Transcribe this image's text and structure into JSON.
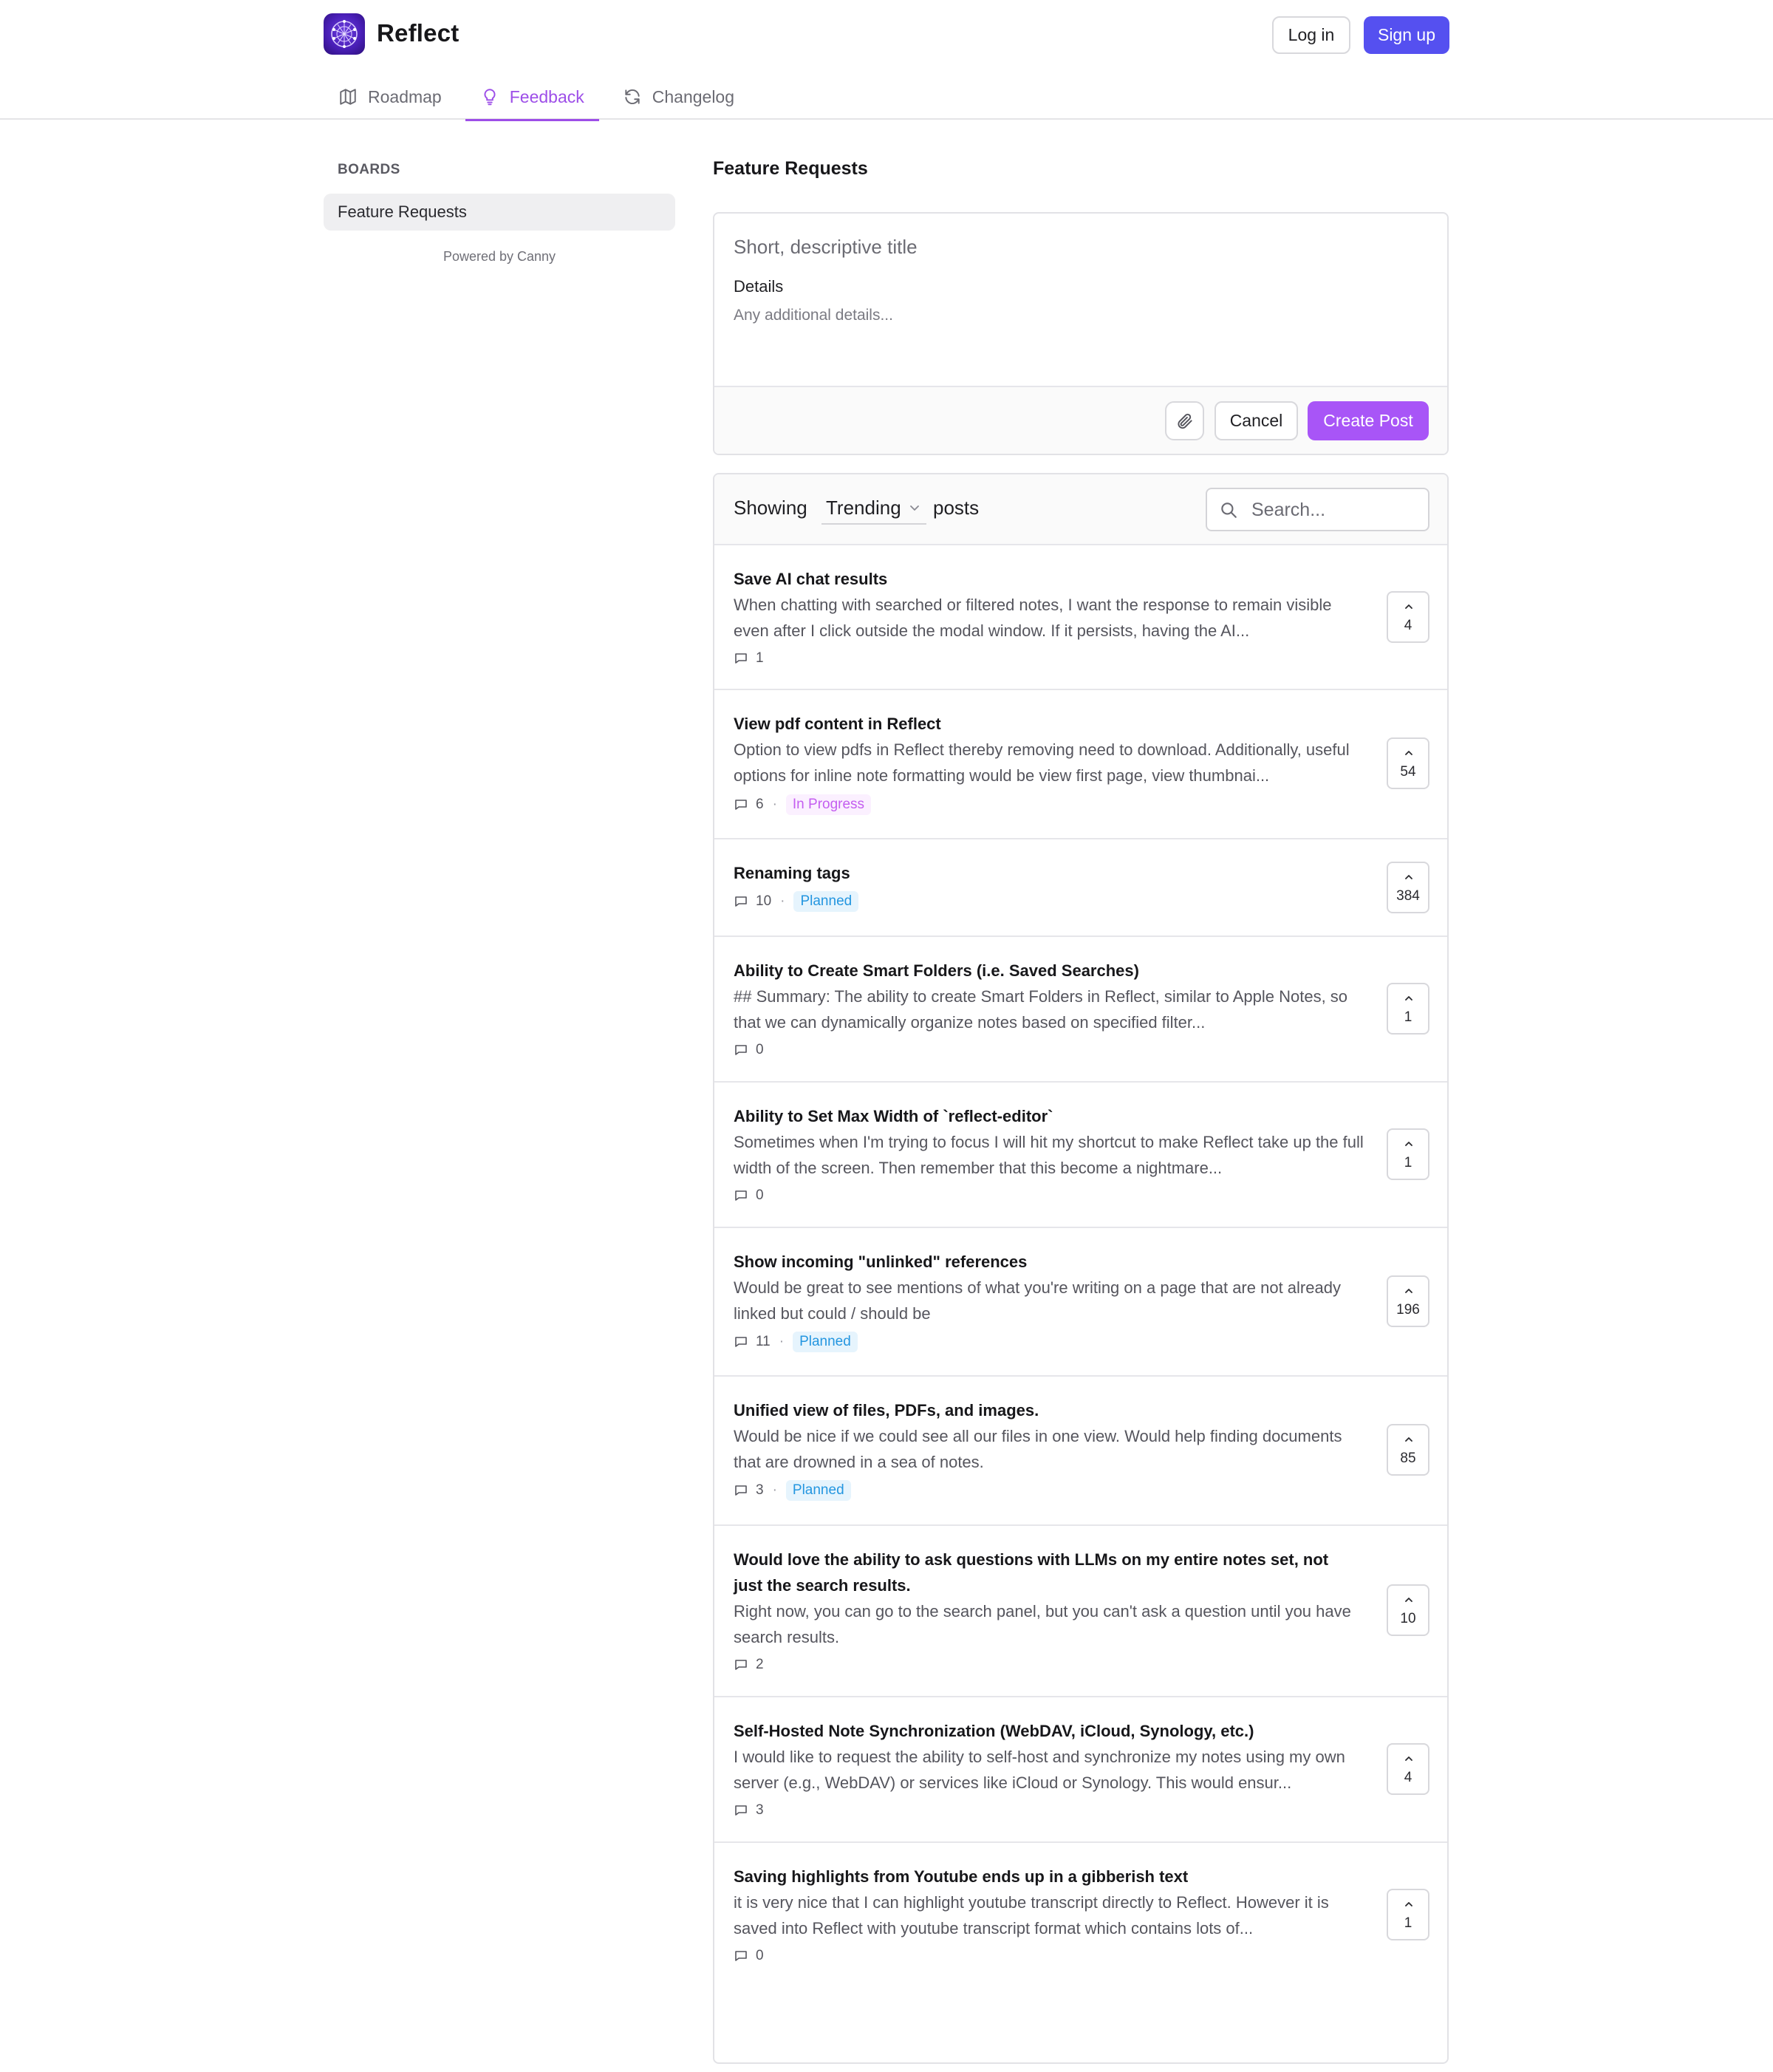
{
  "header": {
    "brand": "Reflect",
    "login_label": "Log in",
    "signup_label": "Sign up",
    "tabs": [
      {
        "label": "Roadmap",
        "icon": "map-icon"
      },
      {
        "label": "Feedback",
        "icon": "lightbulb-icon",
        "active": true
      },
      {
        "label": "Changelog",
        "icon": "refresh-icon"
      }
    ]
  },
  "sidebar": {
    "title": "BOARDS",
    "boards": [
      {
        "label": "Feature Requests",
        "selected": true
      }
    ],
    "powered_by": "Powered by Canny"
  },
  "main": {
    "title": "Feature Requests",
    "composer": {
      "title_placeholder": "Short, descriptive title",
      "details_label": "Details",
      "details_placeholder": "Any additional details...",
      "cancel_label": "Cancel",
      "create_label": "Create Post"
    },
    "list": {
      "showing_label": "Showing",
      "sort_value": "Trending",
      "posts_label": "posts",
      "search_placeholder": "Search..."
    },
    "posts": [
      {
        "title": "Save AI chat results",
        "description": "When chatting with searched or filtered notes, I want the response to remain visible even after I click outside the modal window. If it persists, having the AI...",
        "comments": "1",
        "status": "",
        "votes": "4"
      },
      {
        "title": "View pdf content in Reflect",
        "description": "Option to view pdfs in Reflect thereby removing need to download. Additionally, useful options for inline note formatting would be view first page, view thumbnai...",
        "comments": "6",
        "status": "In Progress",
        "votes": "54"
      },
      {
        "title": "Renaming tags",
        "description": "",
        "comments": "10",
        "status": "Planned",
        "votes": "384"
      },
      {
        "title": "Ability to Create Smart Folders (i.e. Saved Searches)",
        "description": "## Summary: The ability to create Smart Folders in Reflect, similar to Apple Notes, so that we can dynamically organize notes based on specified filter...",
        "comments": "0",
        "status": "",
        "votes": "1"
      },
      {
        "title": "Ability to Set Max Width of `reflect-editor`",
        "description": "Sometimes when I'm trying to focus I will hit my shortcut to make Reflect take up the full width of the screen. Then remember that this become a nightmare...",
        "comments": "0",
        "status": "",
        "votes": "1"
      },
      {
        "title": "Show incoming \"unlinked\" references",
        "description": "Would be great to see mentions of what you're writing on a page that are not already linked but could / should be",
        "comments": "11",
        "status": "Planned",
        "votes": "196"
      },
      {
        "title": "Unified view of files, PDFs, and images.",
        "description": "Would be nice if we could see all our files in one view. Would help finding documents that are drowned in a sea of notes.",
        "comments": "3",
        "status": "Planned",
        "votes": "85"
      },
      {
        "title": "Would love the ability to ask questions with LLMs on my entire notes set, not just the search results.",
        "description": "Right now, you can go to the search panel, but you can't ask a question until you have search results.",
        "comments": "2",
        "status": "",
        "votes": "10"
      },
      {
        "title": "Self-Hosted Note Synchronization (WebDAV, iCloud, Synology, etc.)",
        "description": "I would like to request the ability to self-host and synchronize my notes using my own server (e.g., WebDAV) or services like iCloud or Synology. This would ensur...",
        "comments": "3",
        "status": "",
        "votes": "4"
      },
      {
        "title": "Saving highlights from Youtube ends up in a gibberish text",
        "description": "it is very nice that I can highlight youtube transcript directly to Reflect. However it is saved into Reflect with youtube transcript format which contains lots of...",
        "comments": "0",
        "status": "",
        "votes": "1"
      }
    ]
  },
  "colors": {
    "accent_purple": "#a855f7",
    "signup_blue": "#5550f0",
    "in_progress": "#c45ef0",
    "planned": "#2496e0"
  }
}
